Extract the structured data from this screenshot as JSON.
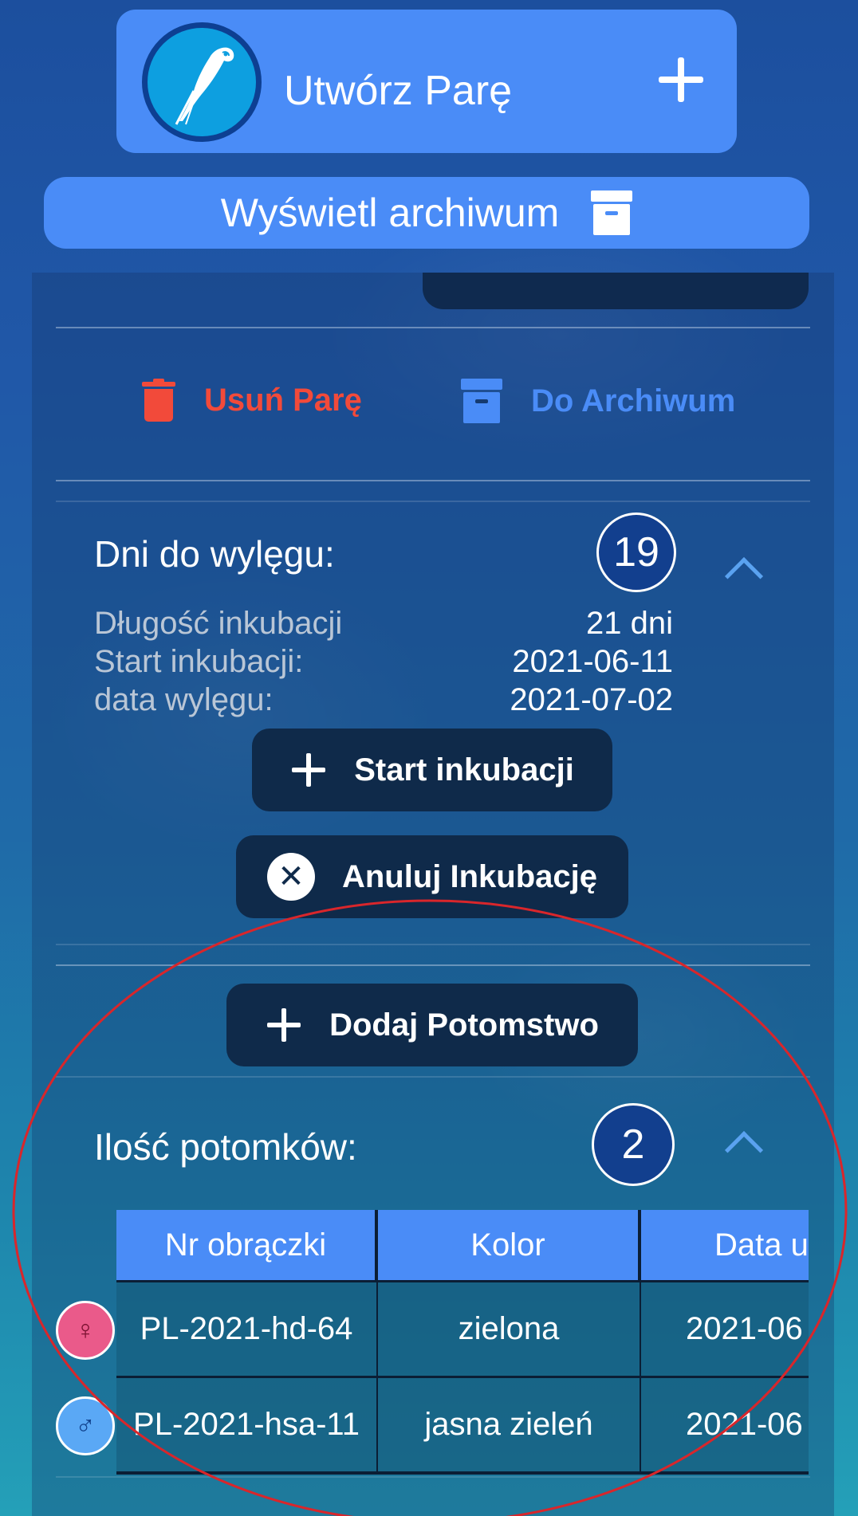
{
  "header": {
    "create_pair_label": "Utwórz Parę",
    "archive_view_label": "Wyświetl archiwum"
  },
  "actions": {
    "delete_label": "Usuń Parę",
    "archive_label": "Do Archiwum"
  },
  "incubation": {
    "title": "Dni do wylęgu:",
    "days_left": "19",
    "length_label": "Długość inkubacji",
    "length_value": "21 dni",
    "start_label": "Start inkubacji:",
    "start_value": "2021-06-11",
    "hatch_label": "data wylęgu:",
    "hatch_value": "2021-07-02",
    "start_button": "Start inkubacji",
    "cancel_button": "Anuluj Inkubację"
  },
  "offspring": {
    "add_button": "Dodaj Potomstwo",
    "title": "Ilość potomków:",
    "count": "2",
    "columns": [
      "Nr obrączki",
      "Kolor",
      "Data u"
    ],
    "rows": [
      {
        "sex": "female",
        "sex_symbol": "♀",
        "ring": "PL-2021-hd-64",
        "color": "zielona",
        "date": "2021-06"
      },
      {
        "sex": "male",
        "sex_symbol": "♂",
        "ring": "PL-2021-hsa-11",
        "color": "jasna zieleń",
        "date": "2021-06"
      }
    ]
  },
  "colors": {
    "accent_blue": "#4a8cf7",
    "danger_red": "#f24a3a",
    "annotation_red": "#d9262b",
    "dark_button": "#0f2a4a"
  },
  "icons": [
    "parrot-logo-icon",
    "plus-icon",
    "archive-box-icon",
    "trash-icon",
    "chevron-up-icon",
    "close-circle-icon",
    "female-icon",
    "male-icon"
  ]
}
